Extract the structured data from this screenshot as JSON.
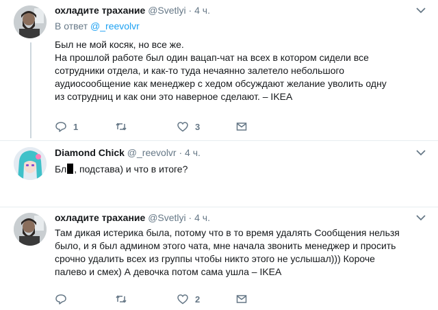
{
  "tweets": [
    {
      "author_name": "охладите трахание",
      "handle": "@Svetlyi",
      "separator": "·",
      "time": "4 ч.",
      "reply_prefix": "В ответ",
      "reply_mention": "@_reevolvr",
      "lines": [
        "Был не мой косяк, но все же.",
        "На прошлой работе был один вацап-чат на всех в котором сидели все",
        "сотрудники отдела, и как-то туда нечаянно залетело небольшого",
        "аудиосообщение как менеджер с хедом обсуждают желание уволить одну",
        "из сотрудниц и как они это наверное сделают. – IKEA"
      ],
      "reply_count": "1",
      "retweet_count": "",
      "like_count": "3"
    },
    {
      "author_name": "Diamond Chick",
      "handle": "@_reevolvr",
      "separator": "·",
      "time": "4 ч.",
      "text_start": "Бл",
      "text_end": ", подстава) и что в итоге?",
      "reply_count": "",
      "retweet_count": "",
      "like_count": ""
    },
    {
      "author_name": "охладите трахание",
      "handle": "@Svetlyi",
      "separator": "·",
      "time": "4 ч.",
      "lines": [
        "Там дикая истерика была, потому что в то время удалять Сообщения нельзя",
        "было, и я был админом этого чата, мне начала звонить менеджер и просить",
        "срочно удалить всех из группы чтобы никто этого не услышал))) Короче",
        "палево и смех) А девочка потом сама ушла – IKEA"
      ],
      "reply_count": "",
      "retweet_count": "",
      "like_count": "2"
    }
  ],
  "icons": {
    "reply": "reply-icon",
    "retweet": "retweet-icon",
    "like": "heart-icon",
    "dm": "envelope-icon",
    "more": "chevron-down-icon"
  },
  "colors": {
    "text": "#14171a",
    "muted": "#657786",
    "link": "#1da1f2",
    "divider": "#e6ecf0",
    "thread_line": "#ccd6dd"
  }
}
